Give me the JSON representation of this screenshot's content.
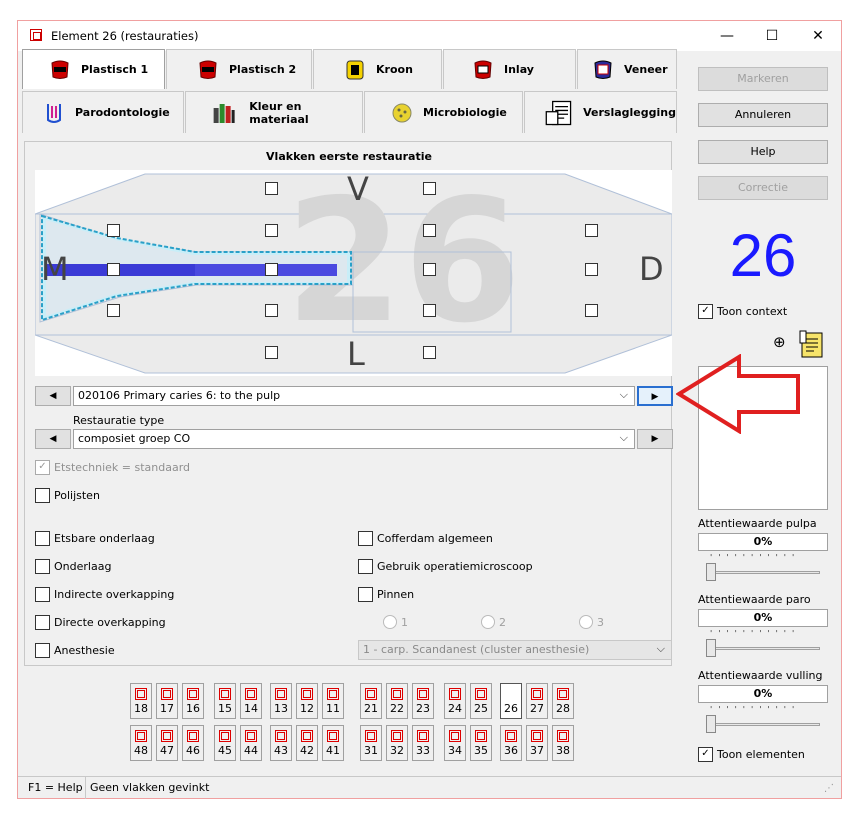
{
  "window": {
    "title": "Element 26 (restauraties)"
  },
  "tabs_row1": [
    {
      "label": "Plastisch 1",
      "active": true
    },
    {
      "label": "Plastisch 2"
    },
    {
      "label": "Kroon"
    },
    {
      "label": "Inlay"
    },
    {
      "label": "Veneer"
    }
  ],
  "tabs_row2": [
    {
      "label": "Parodontologie"
    },
    {
      "label": "Kleur en materiaal"
    },
    {
      "label": "Microbiologie"
    },
    {
      "label": "Verslaglegging"
    }
  ],
  "buttons": {
    "markeren": "Markeren",
    "annuleren": "Annuleren",
    "help": "Help",
    "correctie": "Correctie"
  },
  "element_number": "26",
  "surfaces": {
    "title": "Vlakken eerste restauratie",
    "labels": {
      "v": "V",
      "m": "M",
      "d": "D",
      "l": "L"
    }
  },
  "diagnosis_combo": {
    "value": "020106 Primary caries 6: to the pulp"
  },
  "restauratie_type": {
    "label": "Restauratie type",
    "value": "composiet groep CO"
  },
  "checkboxes": {
    "etstechniek": {
      "label": "Etstechniek = standaard",
      "checked": true,
      "disabled": true
    },
    "polijsten": "Polijsten",
    "etsbare_onderlaag": "Etsbare onderlaag",
    "onderlaag": "Onderlaag",
    "indirecte_overkapping": "Indirecte overkapping",
    "directe_overkapping": "Directe overkapping",
    "anesthesie": "Anesthesie",
    "cofferdam": "Cofferdam algemeen",
    "microscoop": "Gebruik operatiemicroscoop",
    "pinnen": "Pinnen"
  },
  "pin_radios": [
    "1",
    "2",
    "3"
  ],
  "anesthesie_combo": {
    "value": "1 - carp. Scandanest (cluster anesthesie)"
  },
  "elements_upper": [
    "18",
    "17",
    "16",
    "15",
    "14",
    "13",
    "12",
    "11",
    "21",
    "22",
    "23",
    "24",
    "25",
    "26",
    "27",
    "28"
  ],
  "elements_lower": [
    "48",
    "47",
    "46",
    "45",
    "44",
    "43",
    "42",
    "41",
    "31",
    "32",
    "33",
    "34",
    "35",
    "36",
    "37",
    "38"
  ],
  "selected_element": "26",
  "right_panel": {
    "toon_context": "Toon context",
    "toon_elementen": "Toon elementen",
    "pulpa_label": "Attentiewaarde pulpa",
    "pulpa_value": "0%",
    "paro_label": "Attentiewaarde paro",
    "paro_value": "0%",
    "vulling_label": "Attentiewaarde vulling",
    "vulling_value": "0%"
  },
  "status": {
    "help": "F1 = Help",
    "message": "Geen vlakken gevinkt"
  },
  "colors": {
    "accent": "#1a1aff",
    "highlight": "#3333dd",
    "arrow": "#e02020"
  }
}
